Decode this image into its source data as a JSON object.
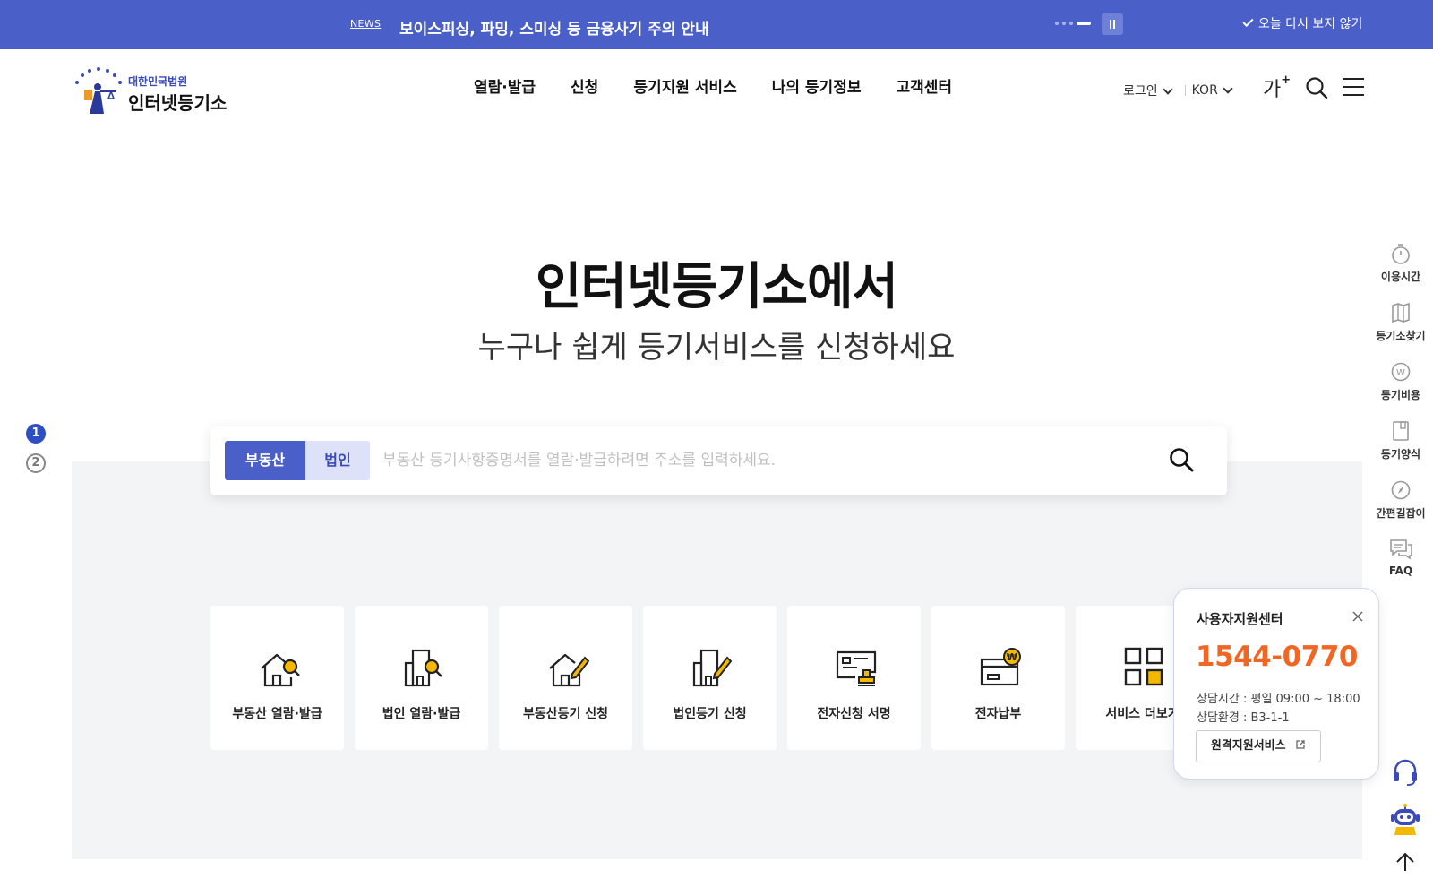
{
  "news": {
    "tag": "NEWS",
    "text": "보이스피싱, 파밍, 스미싱 등 금융사기 주의 안내",
    "dismiss": "오늘 다시 보지 않기"
  },
  "header": {
    "logo_sub": "대한민국법원",
    "logo_main": "인터넷등기소",
    "nav": [
      "열람·발급",
      "신청",
      "등기지원 서비스",
      "나의 등기정보",
      "고객센터"
    ],
    "login": "로그인",
    "lang": "KOR",
    "font_size_label": "가",
    "font_size_plus": "+"
  },
  "hero": {
    "title": "인터넷등기소에서",
    "subtitle": "누구나 쉽게 등기서비스를 신청하세요"
  },
  "pager": [
    "1",
    "2"
  ],
  "search": {
    "tabs": [
      "부동산",
      "법인"
    ],
    "placeholder": "부동산 등기사항증명서를 열람·발급하려면 주소를 입력하세요."
  },
  "cards": [
    {
      "label": "부동산 열람·발급",
      "icon": "house-search-icon"
    },
    {
      "label": "법인 열람·발급",
      "icon": "building-search-icon"
    },
    {
      "label": "부동산등기 신청",
      "icon": "house-pen-icon"
    },
    {
      "label": "법인등기 신청",
      "icon": "building-pen-icon"
    },
    {
      "label": "전자신청 서명",
      "icon": "certificate-sign-icon"
    },
    {
      "label": "전자납부",
      "icon": "won-card-icon"
    },
    {
      "label": "서비스 더보기",
      "icon": "grid-icon"
    }
  ],
  "quick_menu": [
    "이용시간",
    "등기소찾기",
    "등기비용",
    "등기양식",
    "간편길잡이",
    "FAQ"
  ],
  "support": {
    "title": "사용자지원센터",
    "phone": "1544-0770",
    "hours": "상담시간 : 평일 09:00 ~ 18:00",
    "env": "상담환경 : B3-1-1",
    "remote": "원격지원서비스"
  },
  "colors": {
    "brand": "#4a5fc7",
    "accent_orange": "#f26522",
    "icon_yellow": "#f5b800"
  }
}
